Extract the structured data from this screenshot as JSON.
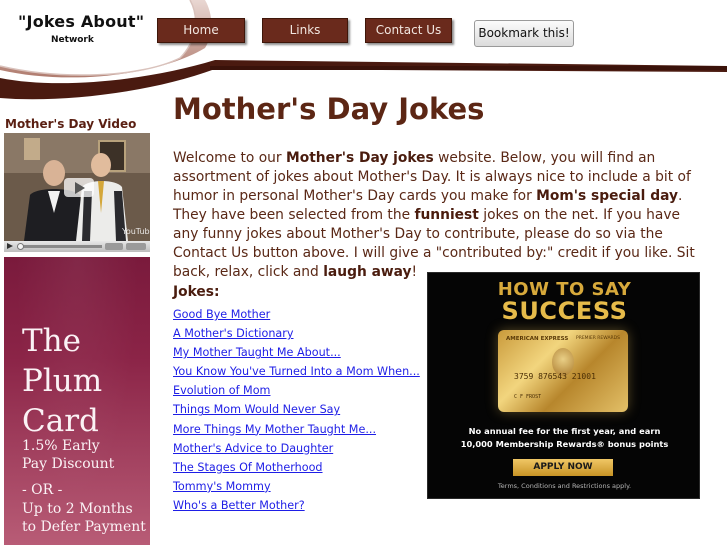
{
  "header": {
    "site_title": "\"Jokes About\"",
    "site_subtitle": "Network",
    "nav": {
      "home": "Home",
      "links": "Links",
      "contact": "Contact Us"
    },
    "bookmark_label": "Bookmark this!"
  },
  "sidebar": {
    "video_title": "Mother's Day Video",
    "video_watermark": "YouTube",
    "ad_lines": [
      "The",
      "Plum",
      "Card",
      "1.5% Early",
      "Pay Discount",
      "- OR -",
      "Up to 2 Months",
      "to Defer Payment"
    ]
  },
  "main": {
    "title": "Mother's Day Jokes",
    "intro": [
      {
        "t": "Welcome to our ",
        "b": false
      },
      {
        "t": "Mother's Day jokes",
        "b": true
      },
      {
        "t": " website. Below, you will find an assortment of jokes about Mother's Day. It is always nice to include a bit of humor in personal Mother's Day cards you make for ",
        "b": false
      },
      {
        "t": "Mom's special day",
        "b": true
      },
      {
        "t": ". They have been selected from the ",
        "b": false
      },
      {
        "t": "funniest",
        "b": true
      },
      {
        "t": " jokes on the net. If you have any funny jokes about Mother's Day to contribute, please do so via the Contact Us button above. I will give a \"contributed by:\" credit if you like. Sit back, relax, click and ",
        "b": false
      },
      {
        "t": "laugh away",
        "b": true
      },
      {
        "t": "!",
        "b": false
      }
    ],
    "jokes_heading": "Jokes:",
    "jokes": [
      "Good Bye Mother",
      "A Mother's Dictionary",
      "My Mother Taught Me About...",
      "You Know You've Turned Into a Mom When...",
      "Evolution of Mom",
      "Things Mom Would Never Say",
      "More Things My Mother Taught Me...",
      "Mother's Advice to Daughter",
      "The Stages Of Motherhood",
      "Tommy's Mommy",
      "Who's a Better Mother?"
    ]
  },
  "ad_right": {
    "headline1": "HOW TO SAY",
    "headline2": "SUCCESS",
    "card_brand": "AMERICAN EXPRESS",
    "card_sub": "PREMIER REWARDS",
    "card_number": "3759  876543  21001",
    "card_name": "C F FROST",
    "offer_line1": "No annual fee for the first year, and earn",
    "offer_line2": "10,000 Membership Rewards® bonus points",
    "cta": "APPLY NOW",
    "terms": "Terms, Conditions and Restrictions apply."
  },
  "colors": {
    "brand_brown": "#5c2614",
    "nav_button": "#6a2a1c",
    "link_blue": "#1e1ee6",
    "ad_gold": "#e6bb4a",
    "plum": "#8b2447"
  }
}
